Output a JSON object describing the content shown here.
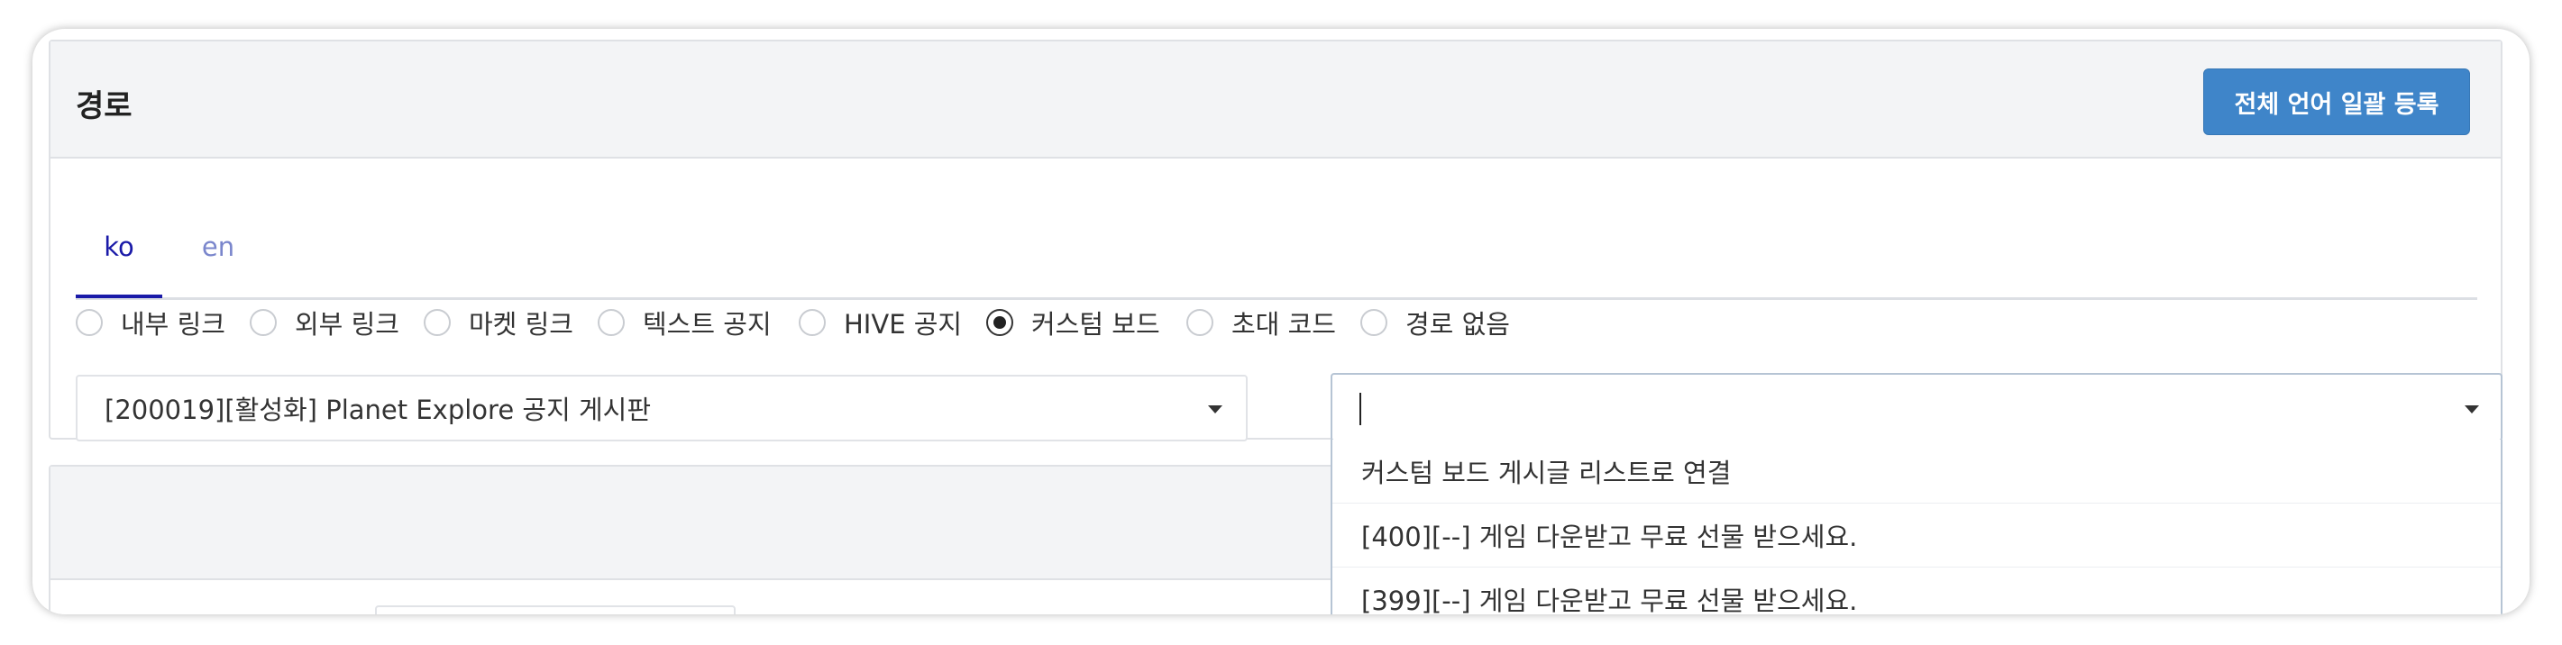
{
  "panel": {
    "title": "경로",
    "bulk_register_button": "전체 언어 일괄 등록"
  },
  "tabs": [
    {
      "label": "ko",
      "active": true
    },
    {
      "label": "en",
      "active": false
    }
  ],
  "radio_options": [
    {
      "label": "내부 링크",
      "checked": false
    },
    {
      "label": "외부 링크",
      "checked": false
    },
    {
      "label": "마켓 링크",
      "checked": false
    },
    {
      "label": "텍스트 공지",
      "checked": false
    },
    {
      "label": "HIVE 공지",
      "checked": false
    },
    {
      "label": "커스텀 보드",
      "checked": true
    },
    {
      "label": "초대 코드",
      "checked": false
    },
    {
      "label": "경로 없음",
      "checked": false
    }
  ],
  "board_select": {
    "value": "[200019][활성화] Planet Explore 공지 게시판"
  },
  "post_select": {
    "value": "",
    "options": [
      "커스텀 보드 게시글 리스트로 연결",
      "[400][--] 게임 다운받고 무료 선물 받으세요.",
      "[399][--] 게임 다운받고 무료 선물 받으세요."
    ]
  }
}
